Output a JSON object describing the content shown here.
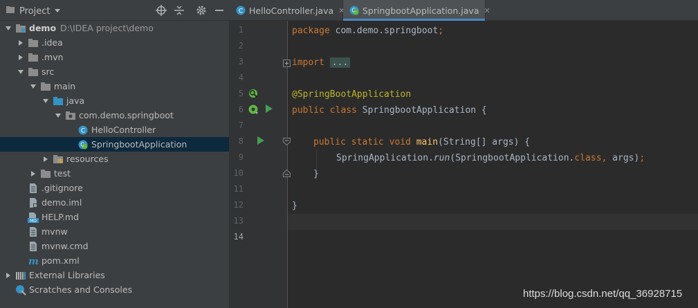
{
  "panel": {
    "title": "Project",
    "buttons": [
      "locate-icon",
      "collapse-icon",
      "gear-icon",
      "minimize-icon"
    ]
  },
  "tree": [
    {
      "label": "demo",
      "hint": "D:\\IDEA project\\demo",
      "depth": 0,
      "expanded": true,
      "icon": "module-folder-icon",
      "bold": true
    },
    {
      "label": ".idea",
      "depth": 1,
      "expanded": false,
      "icon": "folder-icon"
    },
    {
      "label": ".mvn",
      "depth": 1,
      "expanded": false,
      "icon": "folder-icon"
    },
    {
      "label": "src",
      "depth": 1,
      "expanded": true,
      "icon": "folder-icon"
    },
    {
      "label": "main",
      "depth": 2,
      "expanded": true,
      "icon": "folder-icon"
    },
    {
      "label": "java",
      "depth": 3,
      "expanded": true,
      "icon": "source-folder-icon"
    },
    {
      "label": "com.demo.springboot",
      "depth": 4,
      "expanded": true,
      "icon": "package-icon"
    },
    {
      "label": "HelloController",
      "depth": 5,
      "icon": "class-icon"
    },
    {
      "label": "SpringbootApplication",
      "depth": 5,
      "icon": "spring-class-icon",
      "selected": true
    },
    {
      "label": "resources",
      "depth": 3,
      "expanded": false,
      "icon": "resources-folder-icon"
    },
    {
      "label": "test",
      "depth": 2,
      "expanded": false,
      "icon": "folder-icon"
    },
    {
      "label": ".gitignore",
      "depth": 1,
      "icon": "text-file-icon"
    },
    {
      "label": "demo.iml",
      "depth": 1,
      "icon": "iml-file-icon"
    },
    {
      "label": "HELP.md",
      "depth": 1,
      "icon": "md-file-icon"
    },
    {
      "label": "mvnw",
      "depth": 1,
      "icon": "text-file-icon"
    },
    {
      "label": "mvnw.cmd",
      "depth": 1,
      "icon": "text-file-icon"
    },
    {
      "label": "pom.xml",
      "depth": 1,
      "icon": "maven-icon"
    },
    {
      "label": "External Libraries",
      "depth": 0,
      "expanded": false,
      "icon": "libraries-icon"
    },
    {
      "label": "Scratches and Consoles",
      "depth": 0,
      "icon": "scratches-icon"
    }
  ],
  "tabs": [
    {
      "label": "HelloController.java",
      "active": false,
      "icon": "class-icon"
    },
    {
      "label": "SpringbootApplication.java",
      "active": true,
      "icon": "spring-class-icon"
    }
  ],
  "line_numbers": [
    "1",
    "2",
    "3",
    "4",
    "5",
    "6",
    "7",
    "8",
    "9",
    "10",
    "11",
    "12",
    "13",
    "14"
  ],
  "current_line": "14",
  "code": {
    "l1_kw": "package",
    "l1_rest": " com.demo.springboot",
    "l1_semi": ";",
    "l3_kw": "import",
    "l3_fold": "...",
    "l6_ann": "@SpringBootApplication",
    "l7_kw": "public class",
    "l7_rest": " SpringbootApplication {",
    "l9_kw": "public static void",
    "l9_fn": "main",
    "l9_rest": "(String[] args) {",
    "l10_a": "SpringApplication.",
    "l10_run": "run",
    "l10_b": "(SpringbootApplication.",
    "l10_cls": "class",
    "l10_comma": ",",
    "l10_c": " args)",
    "l10_semi": ";",
    "l12_close": "}",
    "l13_close": "}"
  },
  "watermark": "https://blog.csdn.net/qq_36928715",
  "colors": {
    "selection": "#0d293e",
    "tab_underline": "#4a88c7",
    "keyword": "#cc7832",
    "annotation": "#bbb529",
    "method": "#ffc66d"
  }
}
